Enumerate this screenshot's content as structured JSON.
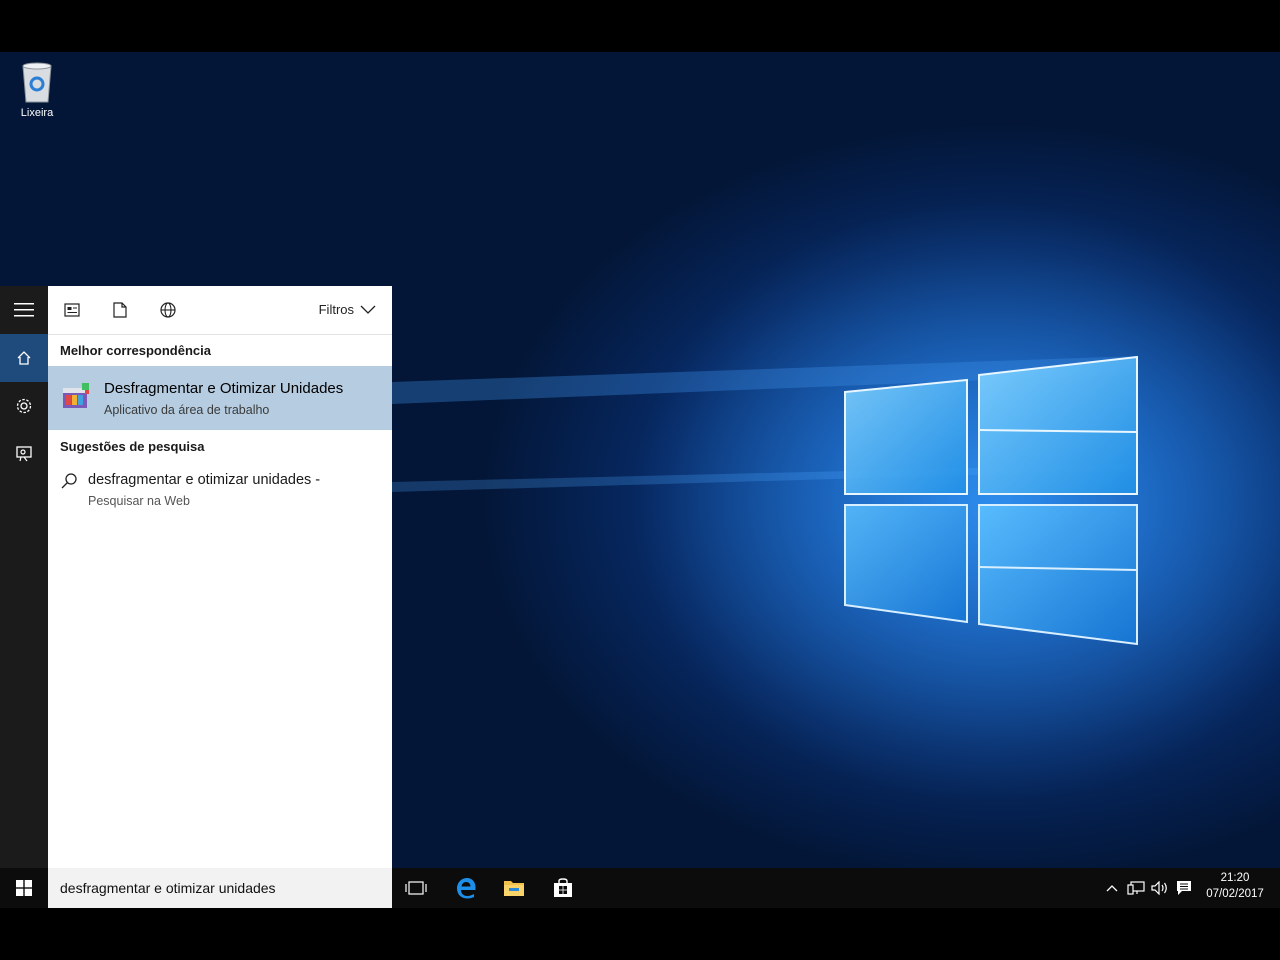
{
  "desktop": {
    "recycle_bin_label": "Lixeira"
  },
  "search_panel": {
    "filters_label": "Filtros",
    "best_match_heading": "Melhor correspondência",
    "best_match": {
      "title": "Desfragmentar e Otimizar Unidades",
      "subtitle": "Aplicativo da área de trabalho",
      "icon": "defrag-app-icon"
    },
    "suggestions_heading": "Sugestões de pesquisa",
    "suggestion": {
      "text": "desfragmentar e otimizar unidades -",
      "subtext": "Pesquisar na Web",
      "icon": "search-icon"
    }
  },
  "taskbar": {
    "search_query": "desfragmentar e otimizar unidades",
    "time": "21:20",
    "date": "07/02/2017",
    "pinned": [
      "task-view-icon",
      "edge-icon",
      "file-explorer-icon",
      "store-icon"
    ],
    "tray": [
      "show-hidden-icons-chevron",
      "network-icon",
      "volume-icon",
      "action-center-icon"
    ]
  },
  "colors": {
    "accent": "#1e4a7c",
    "selection": "#b6cde1",
    "taskbar": "#0c0c0c",
    "rail": "#1b1b1b"
  }
}
